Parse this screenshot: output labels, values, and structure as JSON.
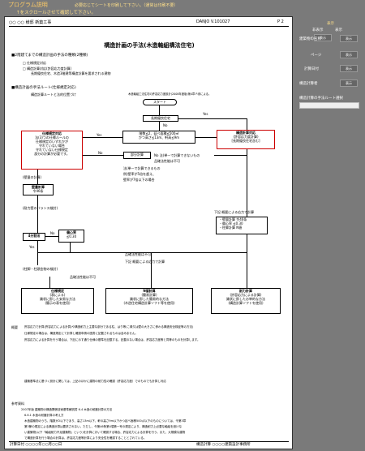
{
  "top": {
    "program_label": "プログラム説明",
    "notice": "必要応じてシートを印刷して下さい。（通常は印刷不要）",
    "scroll_notice": "↑をスクロールさせて確認して下さい。"
  },
  "page": {
    "header_left": "○○ ○○ 様邸 新築工事",
    "doc_number": "DANJO V.101027",
    "page_number": "P 2",
    "title": "構造計画の手法(木造軸組構法住宅)",
    "sec1_heading": "■2階建てまでの構造計画の手法の種類(2種類)",
    "sec1_items": [
      "□ 仕様規定対応",
      "□ 構造計算対応(許容応力度計算)",
      "長期優良住宅、木造3階建等構造計算を要求される建物"
    ],
    "sec2_heading": "■構造計画の手法ルート(仕様規定対応)",
    "sec2_sub": "構造計算ルートと法的位置づけ",
    "flow": {
      "note_top": "木造軸組工法住宅の許容応力度設計(2008年度版)第4章 P.参による。",
      "start": "スタート",
      "chouki": "長期優良住宅",
      "no1": "No",
      "yes1": "Yes",
      "scale": [
        "階数≦2、延べ面積≦500㎡",
        "かつ高さ≦13m、軒高≦9m"
      ],
      "kouzou": [
        "構造計算対応",
        "(許容応力度計算)",
        "[長期優良住宅含む]"
      ],
      "shiyou": [
        "仕様規定対応",
        "法(3)つの仕様ルールの",
        "仕様規定のいずれかが",
        "守れていない場合",
        "守れていない仕様規定",
        "部分の計算が必要です。"
      ],
      "yes2": "Yes",
      "no2": "No",
      "bubun": "部分計算",
      "bubun_note": "No 法(単一で計算できないもの",
      "hinkaku": "品確法性能は不可",
      "bubun_desc": [
        "法(単一で計算できるもの",
        "例)壁率が5倍を超え、",
        "壁率が7倍以下の場合"
      ],
      "kabe_label": "(壁量の計算)",
      "kabe": [
        "壁量計算",
        "令46条"
      ],
      "balance_label": "(耐力壁のバランス検討)",
      "bunkatsu": "4分割法",
      "no3": "No",
      "henshin": [
        "偏心率",
        "≦0.30"
      ],
      "yes3": "Yes",
      "hashira_label": "(柱脚・柱頭金物の検討)",
      "hinkaku2": "品確法性能は不可",
      "kashita": "下記 概要による応力で計算",
      "n_label": "N値計算",
      "note_right": "下記 概要による応力で計算",
      "right_list": [
        "・壁量計算 令46条",
        "・偏心率 ≦0.30",
        "・柱脚計算 N値"
      ],
      "hinkaku3": "品確法性能は可",
      "b1": [
        "仕様規定",
        "(表による)",
        "識状に即した安易な方法",
        "(簡示の表を使用)"
      ],
      "b2": [
        "N値計算",
        "(簡易計算)",
        "識状に即した簡易的な方法",
        "(木造住宅構造計算ソフト等を使用)"
      ],
      "b3": [
        "耐力計算",
        "(許容応力による計算)",
        "識状に即したお単的な方法",
        "(構造計算ソフトを使用)"
      ]
    },
    "gaiyou_label": "概要",
    "gaiyou": [
      "許容応力で計算(許容応力による計算)や構造耐力上主要な部分である柱、はり等(こ縁又は壁の大きさに係わる構造安全検証等の方法)",
      "仕様規定の場合は、構造規定にて計算し確認申請の図書に記載されるものは含みません。",
      "許容応力による計算を行う場合は、下記に示す通り仕様の基準を記載する。記載のない場合は、許容応力度等と同等のものを計算します。"
    ],
    "note_mid": "建築基準法に基づく設計に関しては、上記のほかに建物の耐力性の確認（許容応力度）でのものでも計算し対応",
    "ref_label": "参考資料",
    "refs": [
      "2007年版 建築物の構造関係技術基準解説書 6.4 木造の耐震計算の方法",
      "6.6.1 木造の耐震計算の考え方",
      "木造建築物のうち、階数が2以下であり、高さ13m以下、軒の高さ9m以下かつ延べ面積500㎡以下のものについては、令第3章",
      "第3節の規定による構造計算は要求されない。ただし、令第46条第4項第一号の規定により、構造耐力上必要な軸組を設けな",
      "い建築物(以下「軸組耐力不足建築物」という)を計算において確認する場合、許容応力による計算を行う。また、大規模な建物",
      "で構造計算を行う場合の計算は、許容応力度等計算により安全性を確認することとされている。"
    ],
    "footer_left": "計算日付 ○○○○年○○月○○日",
    "footer_right": "構造計算 ○○○○建築設計事務所"
  },
  "sidebar": {
    "label_display": "表示",
    "label_hide": "非表示",
    "label_list": "表示",
    "rows": [
      {
        "label": "建築物の名称",
        "btn": "表示"
      },
      {
        "label": "ページ",
        "btn": "表示"
      },
      {
        "label": "計算日付",
        "btn": "表示"
      },
      {
        "label": "構造計算者",
        "btn": "表示"
      }
    ],
    "route_label": "構造計算の手法ルート選択"
  }
}
